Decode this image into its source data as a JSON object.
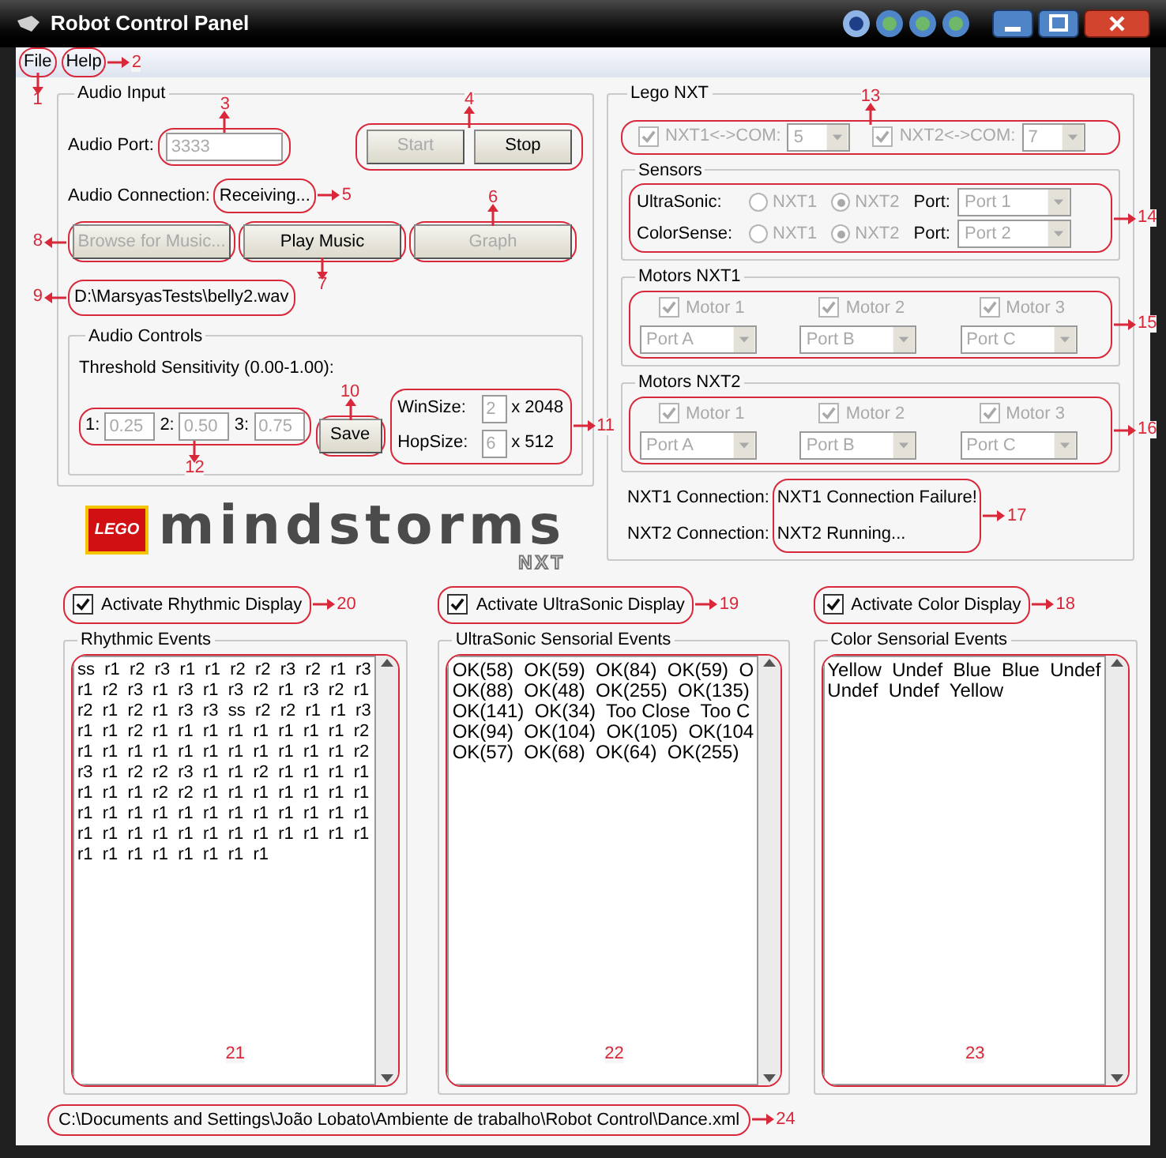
{
  "window": {
    "title": "Robot Control Panel"
  },
  "menu": [
    {
      "label": "File",
      "callout": "1"
    },
    {
      "label": "Help",
      "callout": "2"
    }
  ],
  "audio_input": {
    "title": "Audio Input",
    "port_label": "Audio Port:",
    "port_value": "3333",
    "port_disabled": true,
    "port_callout": "3",
    "buttons": [
      {
        "label": "Start",
        "disabled": true
      },
      {
        "label": "Stop",
        "disabled": false
      }
    ],
    "buttons_callout": "4",
    "connection_label": "Audio Connection:",
    "connection_value": "Receiving...",
    "connection_callout": "5",
    "actions": [
      {
        "label": "Browse for Music...",
        "disabled": true,
        "callout": "8"
      },
      {
        "label": "Play Music",
        "disabled": false,
        "callout": "7"
      },
      {
        "label": "Graph",
        "disabled": true,
        "callout": "6"
      }
    ],
    "file_path": "D:\\MarsyasTests\\belly2.wav",
    "file_callout": "9",
    "audio_controls": {
      "title": "Audio Controls",
      "threshold_label": "Threshold Sensitivity (0.00-1.00):",
      "thresholds": [
        {
          "label": "1:",
          "value": "0.25",
          "disabled": true
        },
        {
          "label": "2:",
          "value": "0.50",
          "disabled": true
        },
        {
          "label": "3:",
          "value": "0.75",
          "disabled": true
        }
      ],
      "thresholds_callout": "12",
      "save_label": "Save",
      "save_callout": "10",
      "sizes": [
        {
          "label": "WinSize:",
          "value": "2",
          "disabled": true,
          "multiplier": "x 2048"
        },
        {
          "label": "HopSize:",
          "value": "6",
          "disabled": true,
          "multiplier": "x 512"
        }
      ],
      "sizes_callout": "11"
    }
  },
  "logo": {
    "brand": "LEGO",
    "word": "mindstorms",
    "sub": "NXT"
  },
  "lego_nxt": {
    "title": "Lego NXT",
    "disabled": true,
    "com": [
      {
        "label": "NXT1<->COM:",
        "checked": true,
        "port": "5"
      },
      {
        "label": "NXT2<->COM:",
        "checked": true,
        "port": "7"
      }
    ],
    "com_callout": "13",
    "sensors": {
      "title": "Sensors",
      "callout": "14",
      "rows": [
        {
          "label": "UltraSonic:",
          "options": [
            {
              "label": "NXT1",
              "selected": false
            },
            {
              "label": "NXT2",
              "selected": true
            }
          ],
          "port_label": "Port:",
          "port": "Port 1"
        },
        {
          "label": "ColorSense:",
          "options": [
            {
              "label": "NXT1",
              "selected": false
            },
            {
              "label": "NXT2",
              "selected": true
            }
          ],
          "port_label": "Port:",
          "port": "Port 2"
        }
      ]
    },
    "motor_groups": [
      {
        "title": "Motors NXT1",
        "callout": "15",
        "motors": [
          {
            "label": "Motor 1",
            "checked": true,
            "port": "Port A"
          },
          {
            "label": "Motor 2",
            "checked": true,
            "port": "Port B"
          },
          {
            "label": "Motor 3",
            "checked": true,
            "port": "Port C"
          }
        ]
      },
      {
        "title": "Motors NXT2",
        "callout": "16",
        "motors": [
          {
            "label": "Motor 1",
            "checked": true,
            "port": "Port A"
          },
          {
            "label": "Motor 2",
            "checked": true,
            "port": "Port B"
          },
          {
            "label": "Motor 3",
            "checked": true,
            "port": "Port C"
          }
        ]
      }
    ],
    "connections": [
      {
        "label": "NXT1 Connection:",
        "value": "NXT1 Connection Failure!"
      },
      {
        "label": "NXT2 Connection:",
        "value": "NXT2 Running..."
      }
    ],
    "connections_callout": "17"
  },
  "displays": [
    {
      "checkbox": "Activate Rhythmic Display",
      "checked": true,
      "checkbox_callout": "20",
      "title": "Rhythmic Events",
      "callout": "21",
      "lines": [
        "ss  r1  r2  r3  r1  r1  r2  r2  r3  r2  r1  r3",
        "r1  r2  r3  r1  r3  r1  r3  r2  r1  r3  r2  r1",
        "r2  r1  r2  r1  r3  r3  ss  r2  r2  r1  r1  r3",
        "r1  r1  r2  r1  r1  r1  r1  r1  r1  r1  r1  r2",
        "r1  r1  r1  r1  r1  r1  r1  r1  r1  r1  r1  r2",
        "r3  r1  r2  r2  r3  r1  r1  r2  r1  r1  r1  r1",
        "r1  r1  r1  r2  r2  r1  r1  r1  r1  r1  r1  r1",
        "r1  r1  r1  r1  r1  r1  r1  r1  r1  r1  r1  r1",
        "r1  r1  r1  r1  r1  r1  r1  r1  r1  r1  r1  r1",
        "r1  r1  r1  r1  r1  r1  r1  r1"
      ]
    },
    {
      "checkbox": "Activate UltraSonic Display",
      "checked": true,
      "checkbox_callout": "19",
      "title": "UltraSonic Sensorial Events",
      "callout": "22",
      "lines": [
        "OK(58)  OK(59)  OK(84)  OK(59)  O",
        "OK(88)  OK(48)  OK(255)  OK(135)",
        "OK(141)  OK(34)  Too Close  Too C",
        "OK(94)  OK(104)  OK(105)  OK(104",
        "OK(57)  OK(68)  OK(64)  OK(255)"
      ]
    },
    {
      "checkbox": "Activate Color Display",
      "checked": true,
      "checkbox_callout": "18",
      "title": "Color Sensorial Events",
      "callout": "23",
      "lines": [
        "Yellow  Undef  Blue  Blue  Undef",
        "Undef  Undef  Yellow"
      ]
    }
  ],
  "status_path": {
    "text": "C:\\Documents and Settings\\João Lobato\\Ambiente de trabalho\\Robot Control\\Dance.xml",
    "callout": "24"
  }
}
